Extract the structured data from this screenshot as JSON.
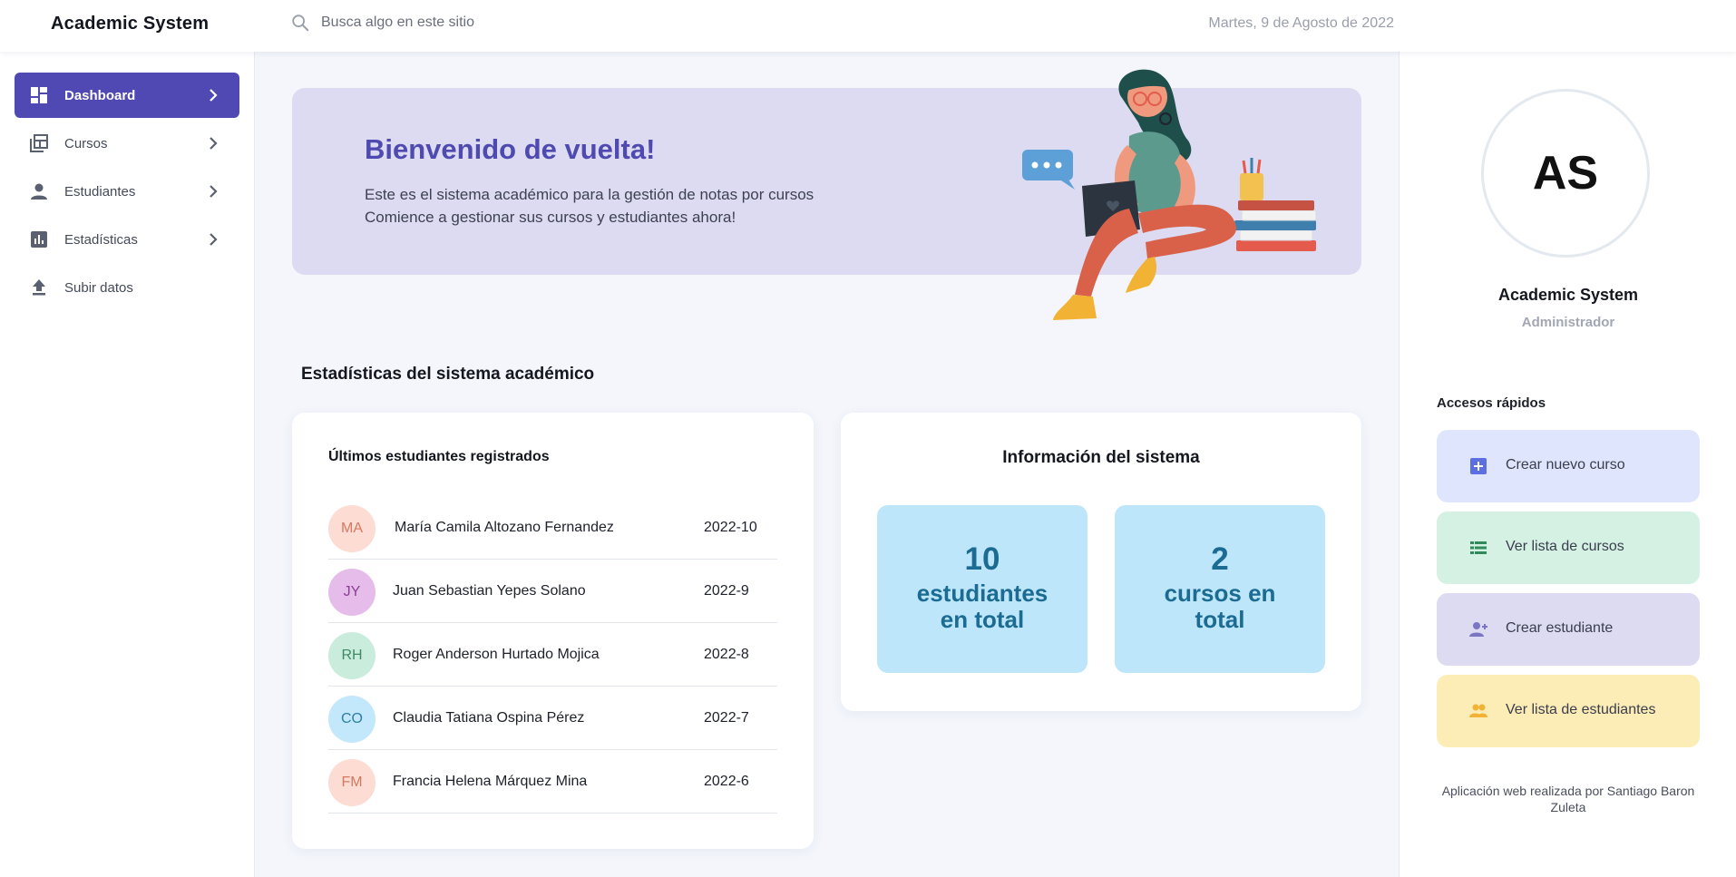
{
  "header": {
    "brand": "Academic System",
    "search_placeholder": "Busca algo en este sitio",
    "date": "Martes, 9 de Agosto de 2022"
  },
  "sidebar": {
    "items": [
      {
        "label": "Dashboard",
        "icon": "dashboard-icon",
        "active": true,
        "has_chevron": true
      },
      {
        "label": "Cursos",
        "icon": "courses-icon",
        "active": false,
        "has_chevron": true
      },
      {
        "label": "Estudiantes",
        "icon": "person-icon",
        "active": false,
        "has_chevron": true
      },
      {
        "label": "Estadísticas",
        "icon": "bar-chart-icon",
        "active": false,
        "has_chevron": true
      },
      {
        "label": "Subir datos",
        "icon": "upload-icon",
        "active": false,
        "has_chevron": false
      }
    ]
  },
  "hero": {
    "title": "Bienvenido de vuelta!",
    "line1": "Este es el sistema académico para la gestión de notas por cursos",
    "line2": "Comience a gestionar sus cursos y estudiantes ahora!"
  },
  "stats_section": {
    "title": "Estadísticas del sistema académico"
  },
  "latest_students": {
    "title": "Últimos estudiantes registrados",
    "rows": [
      {
        "initials": "MA",
        "name": "María Camila Altozano Fernandez",
        "period": "2022-10",
        "bg": "#fddcd3",
        "fg": "#d47a62"
      },
      {
        "initials": "JY",
        "name": "Juan Sebastian Yepes Solano",
        "period": "2022-9",
        "bg": "#e6bdea",
        "fg": "#8a3f93"
      },
      {
        "initials": "RH",
        "name": "Roger Anderson Hurtado Mojica",
        "period": "2022-8",
        "bg": "#c9ecdc",
        "fg": "#3e8a64"
      },
      {
        "initials": "CO",
        "name": "Claudia Tatiana Ospina Pérez",
        "period": "2022-7",
        "bg": "#c3e8fb",
        "fg": "#2f7ea6"
      },
      {
        "initials": "FM",
        "name": "Francia Helena Márquez Mina",
        "period": "2022-6",
        "bg": "#fddcd3",
        "fg": "#d47a62"
      }
    ]
  },
  "system_info": {
    "title": "Información del sistema",
    "students_count": "10",
    "students_label_1": "estudiantes",
    "students_label_2": "en total",
    "courses_count": "2",
    "courses_label_1": "cursos en",
    "courses_label_2": "total"
  },
  "profile": {
    "initials": "AS",
    "name": "Academic System",
    "role": "Administrador"
  },
  "quick_access": {
    "title": "Accesos rápidos",
    "items": [
      {
        "label": "Crear nuevo curso",
        "icon": "add-box-icon",
        "bg": "#dfe5fc",
        "icon_color": "#5c6fe0"
      },
      {
        "label": "Ver lista de cursos",
        "icon": "list-icon",
        "bg": "#d4f1e4",
        "icon_color": "#2f8b5c"
      },
      {
        "label": "Crear estudiante",
        "icon": "add-person-icon",
        "bg": "#dcdbf2",
        "icon_color": "#7b76c4"
      },
      {
        "label": "Ver lista de estudiantes",
        "icon": "group-icon",
        "bg": "#fcecb6",
        "icon_color": "#f2b233"
      }
    ]
  },
  "footer": {
    "credit": "Aplicación web realizada por Santiago Baron Zuleta"
  },
  "colors": {
    "accent": "#5048b3",
    "hero_bg": "#dcdbf2",
    "stat_bg": "#bde6fb",
    "stat_text": "#1b6b92"
  }
}
